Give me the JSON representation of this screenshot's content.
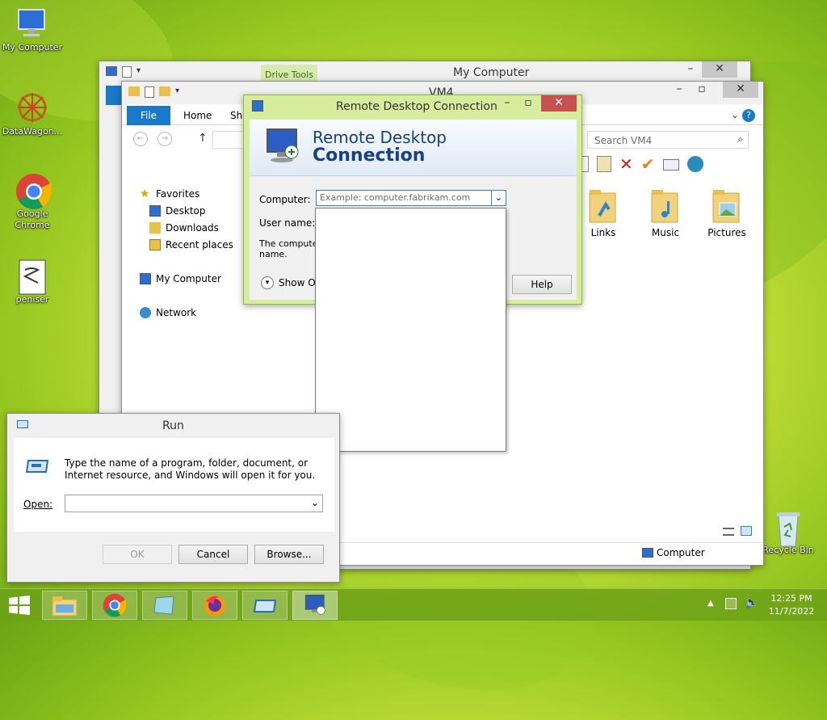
{
  "desktop": {
    "icons": [
      {
        "label": "My Computer"
      },
      {
        "label": "DataWagon..."
      },
      {
        "label": "Google Chrome"
      },
      {
        "label": "peniser"
      }
    ],
    "recycle_bin": "Recycle Bin"
  },
  "explorer_back": {
    "title": "My Computer",
    "contextual_tab": "Drive Tools"
  },
  "explorer_front": {
    "title": "VM4",
    "tabs": [
      "File",
      "Home",
      "Sha"
    ],
    "search_placeholder": "Search VM4",
    "nav": {
      "favorites": "Favorites",
      "desktop": "Desktop",
      "downloads": "Downloads",
      "recent": "Recent places",
      "computer": "My Computer",
      "network": "Network"
    },
    "folders": [
      "Links",
      "Music",
      "Pictures"
    ],
    "status": "Computer"
  },
  "rdc": {
    "title": "Remote Desktop Connection",
    "banner_line1": "Remote Desktop",
    "banner_line2": "Connection",
    "computer_label": "Computer:",
    "computer_placeholder": "Example: computer.fabrikam.com",
    "username_label": "User name:",
    "info_text": "The computer",
    "info_text2": "name.",
    "show_options": "Show Opt",
    "help_button": "Help"
  },
  "run": {
    "title": "Run",
    "description": "Type the name of a program, folder, document, or Internet resource, and Windows will open it for you.",
    "open_label": "Open:",
    "ok_button": "OK",
    "cancel_button": "Cancel",
    "browse_button": "Browse..."
  },
  "taskbar": {
    "time": "12:25 PM",
    "date": "11/7/2022"
  }
}
